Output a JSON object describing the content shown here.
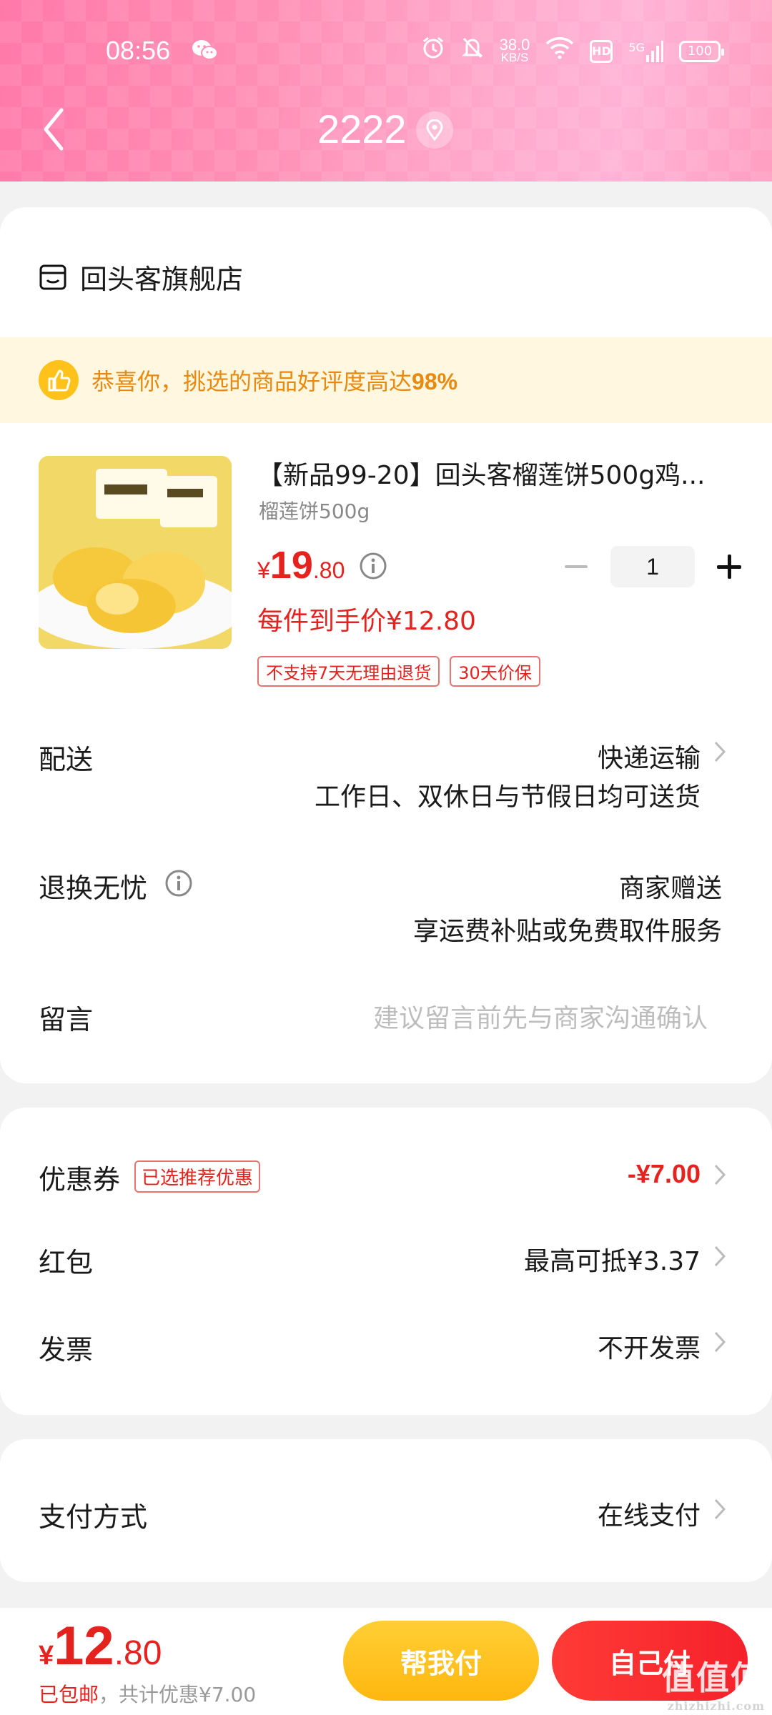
{
  "status_bar": {
    "time": "08:56",
    "net_speed_value": "38.0",
    "net_speed_unit": "KB/S",
    "hd": "HD",
    "signal": "5G",
    "battery": "100"
  },
  "nav": {
    "title": "2222"
  },
  "store": {
    "name": "回头客旗舰店"
  },
  "praise": {
    "text_prefix": "恭喜你，挑选的商品好评度高达",
    "percent": "98%"
  },
  "product": {
    "title": "【新品99-20】回头客榴莲饼500g鸡...",
    "spec": "榴莲饼500g",
    "price_yen": "¥",
    "price_int": "19",
    "price_dec": ".80",
    "quantity": "1",
    "hand_price": "每件到手价¥12.80",
    "tags": [
      "不支持7天无理由退货",
      "30天价保"
    ]
  },
  "delivery": {
    "label": "配送",
    "method": "快递运输",
    "note": "工作日、双休日与节假日均可送货"
  },
  "returns": {
    "label": "退换无忧",
    "value": "商家赠送",
    "note": "享运费补贴或免费取件服务"
  },
  "message": {
    "label": "留言",
    "placeholder": "建议留言前先与商家沟通确认"
  },
  "coupon": {
    "label": "优惠券",
    "tag": "已选推荐优惠",
    "value": "-¥7.00"
  },
  "red_packet": {
    "label": "红包",
    "value": "最高可抵¥3.37"
  },
  "invoice": {
    "label": "发票",
    "value": "不开发票"
  },
  "payment": {
    "label": "支付方式",
    "value": "在线支付"
  },
  "bottom": {
    "total_yen": "¥",
    "total_int": "12",
    "total_dec": ".80",
    "ship_free": "已包邮",
    "discount_note": "，共计优惠¥7.00",
    "help_pay": "帮我付",
    "self_pay": "自己付"
  },
  "watermark": {
    "text": "值值值",
    "sub": "zhizhizhi.com"
  }
}
